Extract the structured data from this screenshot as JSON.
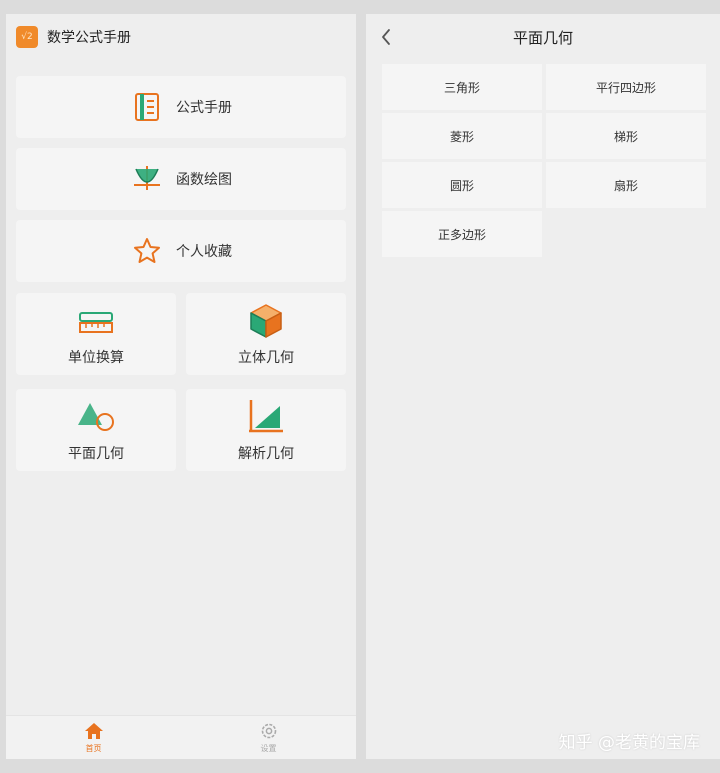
{
  "left": {
    "app_title": "数学公式手册",
    "app_logo_text": "√2",
    "menu": [
      {
        "label": "公式手册",
        "icon": "formula-book-icon"
      },
      {
        "label": "函数绘图",
        "icon": "function-plot-icon"
      },
      {
        "label": "个人收藏",
        "icon": "star-icon"
      },
      {
        "label": "单位换算",
        "icon": "ruler-icon"
      },
      {
        "label": "立体几何",
        "icon": "cube-icon"
      },
      {
        "label": "平面几何",
        "icon": "plane-geometry-icon"
      },
      {
        "label": "解析几何",
        "icon": "analytic-geometry-icon"
      }
    ],
    "tabs": [
      {
        "label": "首页",
        "icon": "home-icon",
        "active": true
      },
      {
        "label": "设置",
        "icon": "settings-icon",
        "active": false
      }
    ]
  },
  "right": {
    "title": "平面几何",
    "items": [
      "三角形",
      "平行四边形",
      "菱形",
      "梯形",
      "圆形",
      "扇形",
      "正多边形"
    ]
  },
  "watermark": "知乎 @老黄的宝库",
  "colors": {
    "accent": "#e8731f",
    "green": "#2aa876",
    "background": "#eeeeee",
    "card": "#f5f5f5"
  }
}
